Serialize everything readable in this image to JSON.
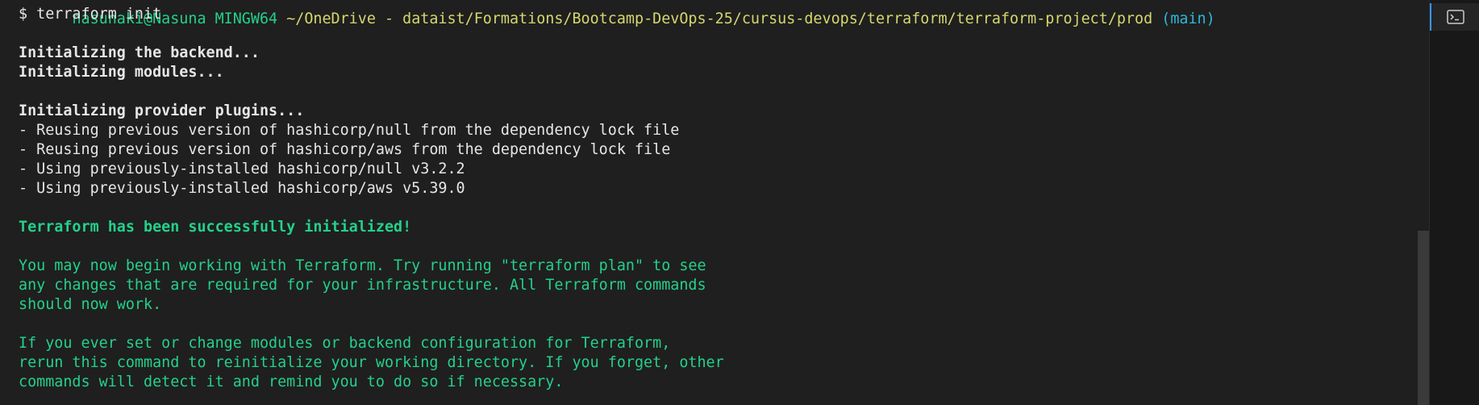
{
  "prompt": {
    "user_host": "nasunaki@Nasuna MINGW64",
    "path": " ~/OneDrive - dataist/Formations/Bootcamp-DevOps-25/cursus-devops/terraform/terraform-project/prod",
    "branch": " (main)"
  },
  "lines": {
    "command": "$ terraform init",
    "backend": "Initializing the backend...",
    "modules": "Initializing modules...",
    "plugins": "Initializing provider plugins...",
    "reuse_null": "- Reusing previous version of hashicorp/null from the dependency lock file",
    "reuse_aws": "- Reusing previous version of hashicorp/aws from the dependency lock file",
    "installed_null": "- Using previously-installed hashicorp/null v3.2.2",
    "installed_aws": "- Using previously-installed hashicorp/aws v5.39.0",
    "success": "Terraform has been successfully initialized!",
    "info_1": "You may now begin working with Terraform. Try running \"terraform plan\" to see",
    "info_2": "any changes that are required for your infrastructure. All Terraform commands",
    "info_3": "should now work.",
    "info_4": "If you ever set or change modules or backend configuration for Terraform,",
    "info_5": "rerun this command to reinitialize your working directory. If you forget, other",
    "info_6": "commands will detect it and remind you to do so if necessary."
  },
  "side_panel": {
    "icon": "terminal-icon"
  },
  "colors": {
    "background": "#1f1f1f",
    "text": "#e6e6e6",
    "success_green": "#23d18b",
    "prompt_path": "#d6d66e",
    "prompt_branch": "#29b8db",
    "accent": "#3794ff"
  }
}
